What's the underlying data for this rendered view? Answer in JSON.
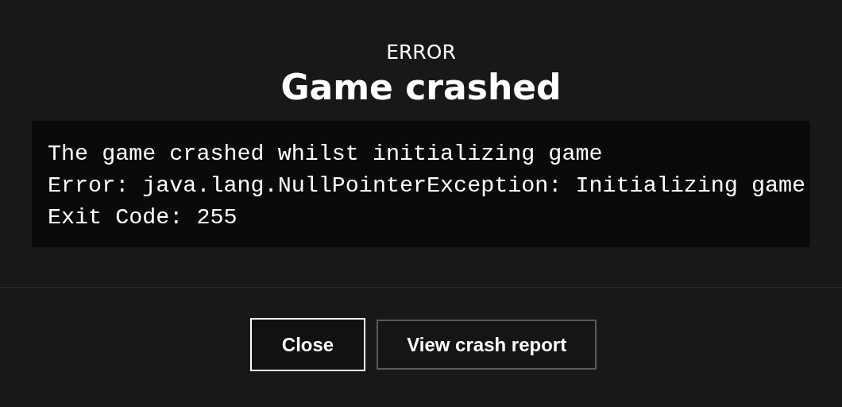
{
  "dialog": {
    "kicker": "ERROR",
    "title": "Game crashed",
    "log_lines": [
      "The game crashed whilst initializing game",
      "Error: java.lang.NullPointerException: Initializing game",
      "Exit Code: 255"
    ],
    "buttons": [
      {
        "label": "Close",
        "focused": true
      },
      {
        "label": "View crash report",
        "focused": false
      }
    ]
  }
}
